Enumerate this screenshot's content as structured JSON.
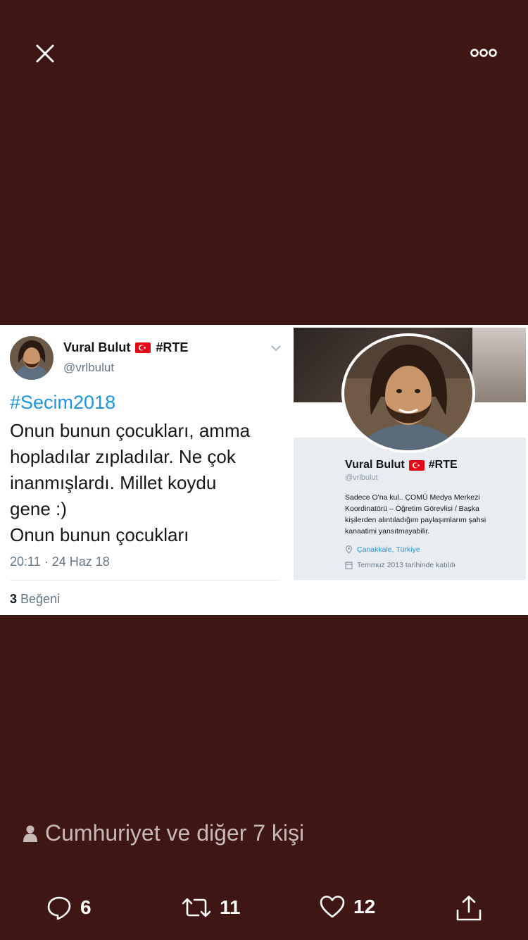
{
  "topbar": {
    "close_icon": "close-icon",
    "more_icon": "more-icon"
  },
  "tweet_image": {
    "tweet": {
      "name": "Vural Bulut",
      "name_tag": "#RTE",
      "handle": "@vrlbulut",
      "hashtag": "#Secim2018",
      "text_lines": [
        "Onun bunun çocukları, amma",
        "hopladılar zıpladılar. Ne çok",
        "inanmışlardı. Millet koydu",
        "gene :)",
        "Onun bunun çocukları"
      ],
      "time": "20:11 · 24 Haz 18",
      "likes_count": "3",
      "likes_label": "Beğeni"
    },
    "profile": {
      "name": "Vural Bulut",
      "name_tag": "#RTE",
      "handle": "@vrlbulut",
      "bio_lines": [
        "Sadece O'na kul.. ÇOMÜ Medya Merkezi",
        "Koordinatörü – Öğretim Görevlisi / Başka",
        "kişilerden alıntıladığım paylaşımlarım şahsi",
        "kanaatimi yansıtmayabilir."
      ],
      "location": "Çanakkale, Türkiye",
      "joined": "Temmuz 2013 tarihinde katıldı"
    }
  },
  "social_context": "Cumhuriyet ve diğer 7 kişi",
  "actions": {
    "reply_count": "6",
    "retweet_count": "11",
    "like_count": "12"
  },
  "colors": {
    "background": "#3e1614",
    "link": "#1b95e0",
    "flag": "#e30a17"
  }
}
